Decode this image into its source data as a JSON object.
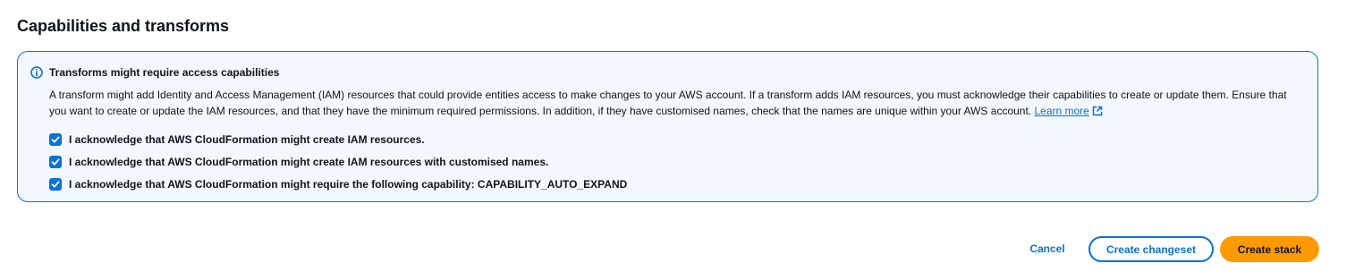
{
  "section": {
    "title": "Capabilities and transforms"
  },
  "alert": {
    "icon": "info-icon",
    "heading": "Transforms might require access capabilities",
    "body": "A transform might add Identity and Access Management (IAM) resources that could provide entities access to make changes to your AWS account. If a transform adds IAM resources, you must acknowledge their capabilities to create or update them. Ensure that you want to create or update the IAM resources, and that they have the minimum required permissions. In addition, if they have customised names, check that the names are unique within your AWS account.",
    "learn_more_label": "Learn more",
    "learn_more_icon": "external-link-icon",
    "acknowledgements": [
      {
        "label": "I acknowledge that AWS CloudFormation might create IAM resources.",
        "checked": true
      },
      {
        "label": "I acknowledge that AWS CloudFormation might create IAM resources with customised names.",
        "checked": true
      },
      {
        "label": "I acknowledge that AWS CloudFormation might require the following capability: CAPABILITY_AUTO_EXPAND",
        "checked": true
      }
    ]
  },
  "actions": {
    "cancel_label": "Cancel",
    "create_changeset_label": "Create changeset",
    "create_stack_label": "Create stack"
  },
  "colors": {
    "accent": "#0972d3",
    "alert_background": "#f2f8fd",
    "primary_button": "#ff9900",
    "text": "#0f141a"
  }
}
